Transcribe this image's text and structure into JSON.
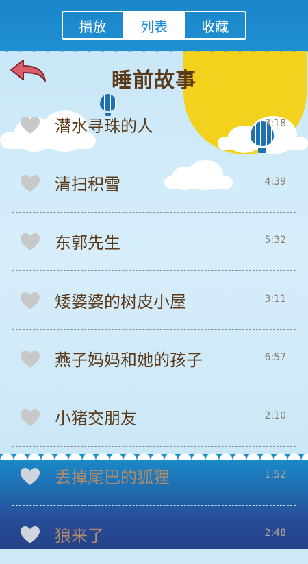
{
  "tabs": [
    {
      "label": "播放",
      "active": false
    },
    {
      "label": "列表",
      "active": true
    },
    {
      "label": "收藏",
      "active": false
    }
  ],
  "header": {
    "title": "睡前故事",
    "back_icon": "back-arrow-icon"
  },
  "stories": [
    {
      "title": "潜水寻珠的人",
      "duration": "3:18"
    },
    {
      "title": "清扫积雪",
      "duration": "4:39"
    },
    {
      "title": "东郭先生",
      "duration": "5:32"
    },
    {
      "title": "矮婆婆的树皮小屋",
      "duration": "3:11"
    },
    {
      "title": "燕子妈妈和她的孩子",
      "duration": "6:57"
    },
    {
      "title": "小猪交朋友",
      "duration": "2:10"
    },
    {
      "title": "丢掉尾巴的狐狸",
      "duration": "1:52"
    },
    {
      "title": "狼来了",
      "duration": "2:48"
    }
  ],
  "colors": {
    "accent": "#1f8fd2",
    "title_text": "#5a3a1a",
    "heart": "#c8c8c8",
    "sun": "#f2d21c"
  }
}
